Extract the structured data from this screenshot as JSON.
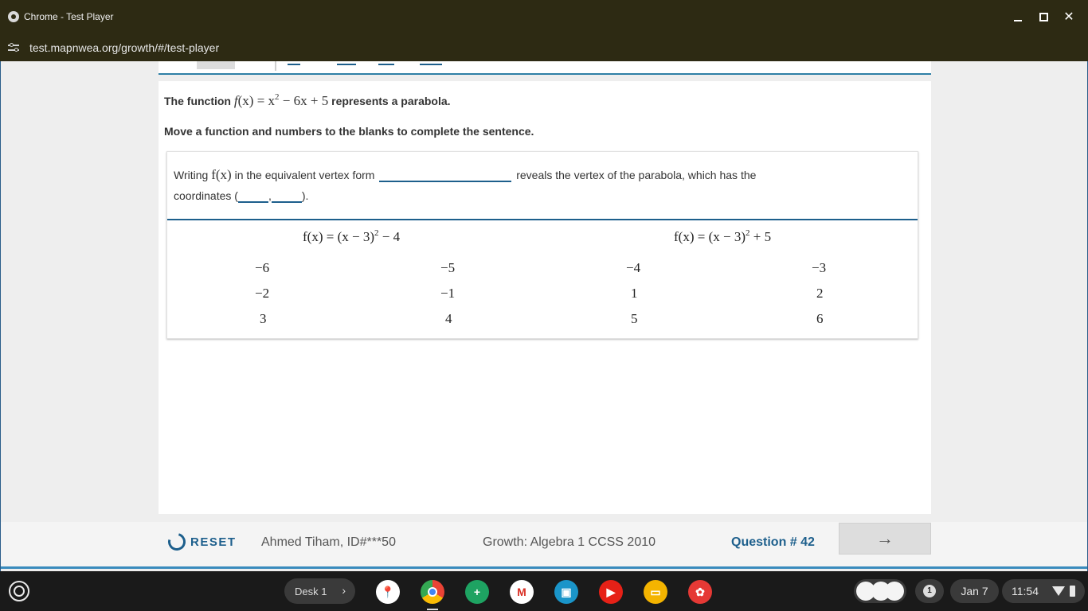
{
  "window": {
    "title": "Chrome - Test Player",
    "url": "test.mapnwea.org/growth/#/test-player",
    "close_glyph": "✕"
  },
  "question": {
    "prompt_prefix": "The function ",
    "prompt_fn": "f",
    "prompt_x": "(x) = x",
    "prompt_exp": "2",
    "prompt_rest": " − 6x + 5",
    "prompt_suffix": " represents a parabola.",
    "instruction": "Move a function and numbers to the blanks to complete the sentence.",
    "sentence_part1": "Writing ",
    "sentence_math": "f(x)",
    "sentence_part2": " in the equivalent vertex form ",
    "sentence_part3": " reveals the vertex of the parabola, which has the coordinates (",
    "sentence_comma": ",",
    "sentence_end": ")."
  },
  "options": {
    "functions": [
      {
        "base": "f(x) = (x − 3)",
        "exp": "2",
        "tail": " − 4"
      },
      {
        "base": "f(x) = (x − 3)",
        "exp": "2",
        "tail": " + 5"
      }
    ],
    "numbers": [
      "−6",
      "−5",
      "−4",
      "−3",
      "−2",
      "−1",
      "1",
      "2",
      "3",
      "4",
      "5",
      "6"
    ]
  },
  "footer": {
    "reset_label": "RESET",
    "student": "Ahmed Tiham, ID#***50",
    "test_name": "Growth: Algebra 1 CCSS 2010",
    "question_number": "Question # 42",
    "next_glyph": "→"
  },
  "shelf": {
    "desk_label": "Desk 1",
    "desk_chevron": "›",
    "notification_count": "1",
    "date": "Jan 7",
    "time": "11:54",
    "apps": [
      {
        "name": "maps-app-icon",
        "color": "#ffffff",
        "glyph": "📍"
      },
      {
        "name": "chrome-app-icon",
        "color": "#4285f4",
        "glyph": ""
      },
      {
        "name": "sheets-app-icon",
        "color": "#1ea362",
        "glyph": "+"
      },
      {
        "name": "gmail-app-icon",
        "color": "#ffffff",
        "glyph": "M"
      },
      {
        "name": "classroom-app-icon",
        "color": "#1a95c9",
        "glyph": "▣"
      },
      {
        "name": "youtube-app-icon",
        "color": "#e62117",
        "glyph": "▶"
      },
      {
        "name": "slides-app-icon",
        "color": "#f4b400",
        "glyph": "▭"
      },
      {
        "name": "canvas-app-icon",
        "color": "#e53935",
        "glyph": "✿"
      }
    ]
  }
}
